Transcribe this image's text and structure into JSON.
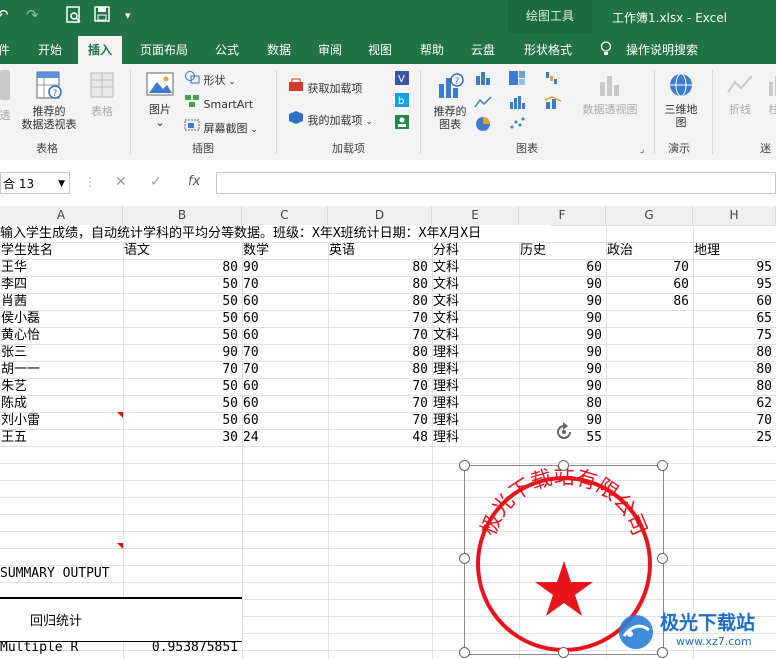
{
  "titlebar": {
    "context_tab": "绘图工具",
    "doc_title": "工作簿1.xlsx  -  Excel",
    "undo_icon": "undo-icon",
    "redo_icon": "redo-icon",
    "print_preview_icon": "print-preview-icon",
    "save_icon": "save-icon",
    "qat_more_icon": "more-icon"
  },
  "tabs": [
    "件",
    "开始",
    "插入",
    "页面布局",
    "公式",
    "数据",
    "审阅",
    "视图",
    "帮助",
    "云盘",
    "形状格式"
  ],
  "tell_me": "操作说明搜索",
  "ribbon": {
    "groups": [
      "表格",
      "插图",
      "加载项",
      "图表",
      "演示",
      "迷"
    ],
    "pivot_partial": "透",
    "rec_pivot": [
      "推荐的",
      "数据透视表"
    ],
    "table": "表格",
    "picture": "图片",
    "shapes": "形状",
    "smartart": "SmartArt",
    "screenshot": "屏幕截图",
    "get_addins": "获取加载项",
    "my_addins": "我的加载项",
    "rec_charts": [
      "推荐的",
      "图表"
    ],
    "pivot_chart": "数据透视图",
    "map3d": [
      "三维地",
      "图"
    ],
    "sparkline_line": "折线",
    "sparkline_col": "柱"
  },
  "formula_bar": {
    "name_box": "合 13",
    "cancel": "✕",
    "enter": "✓",
    "fx": "fx",
    "value": ""
  },
  "columns": [
    "A",
    "B",
    "C",
    "D",
    "E",
    "F",
    "G",
    "H"
  ],
  "sheet": {
    "row1": "输入学生成绩，自动统计学科的平均分等数据。班级：X年X班统计日期：X年X月X日",
    "headers": [
      "学生姓名",
      "语文",
      "数学",
      "英语",
      "分科",
      "历史",
      "政治",
      "地理"
    ],
    "rows": [
      [
        "王华",
        "80",
        "90",
        "80",
        "文科",
        "60",
        "70",
        "95"
      ],
      [
        "李四",
        "50",
        "70",
        "80",
        "文科",
        "90",
        "60",
        "95"
      ],
      [
        "肖茜",
        "50",
        "60",
        "80",
        "文科",
        "90",
        "86",
        "60"
      ],
      [
        "侯小磊",
        "50",
        "60",
        "70",
        "文科",
        "90",
        "",
        "65"
      ],
      [
        "黄心怡",
        "50",
        "60",
        "70",
        "文科",
        "90",
        "",
        "75"
      ],
      [
        "张三",
        "90",
        "70",
        "80",
        "理科",
        "90",
        "",
        "80"
      ],
      [
        "胡一一",
        "70",
        "70",
        "80",
        "理科",
        "90",
        "",
        "80"
      ],
      [
        "朱艺",
        "50",
        "60",
        "70",
        "理科",
        "90",
        "",
        "80"
      ],
      [
        "陈成",
        "50",
        "60",
        "70",
        "理科",
        "80",
        "",
        "62"
      ],
      [
        "刘小雷",
        "50",
        "60",
        "70",
        "理科",
        "90",
        "",
        "70"
      ],
      [
        "王五",
        "30",
        "24",
        "48",
        "理科",
        "55",
        "",
        "25"
      ]
    ],
    "summary_title": "SUMMARY OUTPUT",
    "regression_label": "回归统计",
    "multiple_r_label": "Multiple R",
    "multiple_r_value": "0.953875851"
  },
  "stamp": {
    "text": "极光下载站有限公司",
    "color": "#e8141c"
  },
  "watermark": {
    "text": "极光下载站",
    "url": "www.xz7.com"
  },
  "colors": {
    "excel_green": "#217346",
    "note_red": "#e00000"
  }
}
